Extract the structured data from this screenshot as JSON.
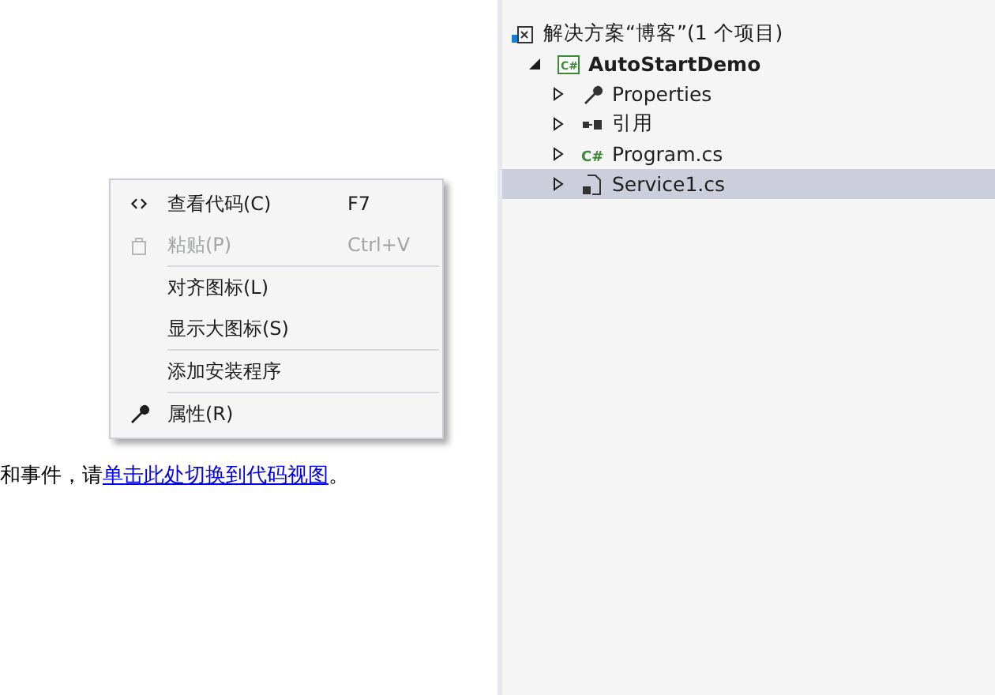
{
  "designer": {
    "message": {
      "before": "和事件，请",
      "link": "单击此处切换到代码视图",
      "after": "。"
    }
  },
  "context_menu": {
    "items": [
      {
        "kind": "code",
        "label": "查看代码(C)",
        "shortcut": "F7",
        "disabled": false
      },
      {
        "kind": "paste",
        "label": "粘贴(P)",
        "shortcut": "Ctrl+V",
        "disabled": true
      },
      {
        "kind": "separator"
      },
      {
        "kind": "none",
        "label": "对齐图标(L)",
        "disabled": false
      },
      {
        "kind": "none",
        "label": "显示大图标(S)",
        "disabled": false
      },
      {
        "kind": "separator"
      },
      {
        "kind": "none",
        "label": "添加安装程序",
        "disabled": false
      },
      {
        "kind": "separator"
      },
      {
        "kind": "wrench",
        "label": "属性(R)",
        "disabled": false
      }
    ]
  },
  "solution_explorer": {
    "tree": [
      {
        "kind": "solution",
        "label": "解决方案“博客”(1 个项目)",
        "selected": false,
        "children": [
          {
            "kind": "project",
            "icon_text": "C#",
            "label": "AutoStartDemo",
            "expanded": true,
            "selected": false,
            "children": [
              {
                "kind": "wrench",
                "label": "Properties",
                "expanded": false,
                "selected": false
              },
              {
                "kind": "references",
                "label": "引用",
                "expanded": false,
                "selected": false
              },
              {
                "kind": "csharp",
                "icon_text": "C#",
                "label": "Program.cs",
                "expanded": false,
                "selected": false
              },
              {
                "kind": "service",
                "label": "Service1.cs",
                "expanded": false,
                "selected": true
              }
            ]
          }
        ]
      }
    ]
  }
}
